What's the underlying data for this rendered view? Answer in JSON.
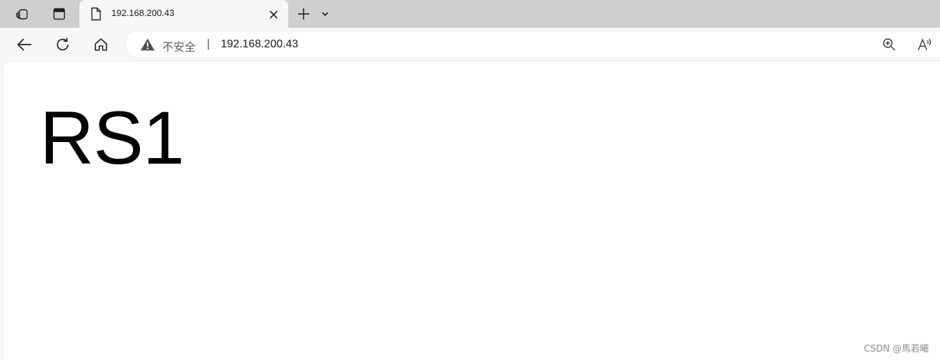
{
  "tabstrip": {
    "workspaces_icon": "workspaces-icon",
    "vertical_tabs_icon": "vertical-tabs-icon",
    "new_tab_icon": "plus-icon",
    "tab_actions_icon": "chevron-down-icon"
  },
  "tab": {
    "title": "192.168.200.43",
    "icon": "page-icon",
    "close_icon": "close-icon"
  },
  "toolbar": {
    "back_icon": "back-arrow-icon",
    "refresh_icon": "refresh-icon",
    "home_icon": "home-icon"
  },
  "addressbar": {
    "security_icon": "warning-icon",
    "security_label": "不安全",
    "separator": "|",
    "url": "192.168.200.43",
    "zoom_icon": "zoom-in-icon",
    "read_aloud_icon": "read-aloud-icon"
  },
  "page": {
    "heading": "RS1"
  },
  "watermark": "CSDN @馬若曦",
  "colors": {
    "tabstrip_bg": "#cfcfcf",
    "toolbar_bg": "#f7f7f7",
    "page_bg": "#ffffff",
    "text": "#000000"
  }
}
